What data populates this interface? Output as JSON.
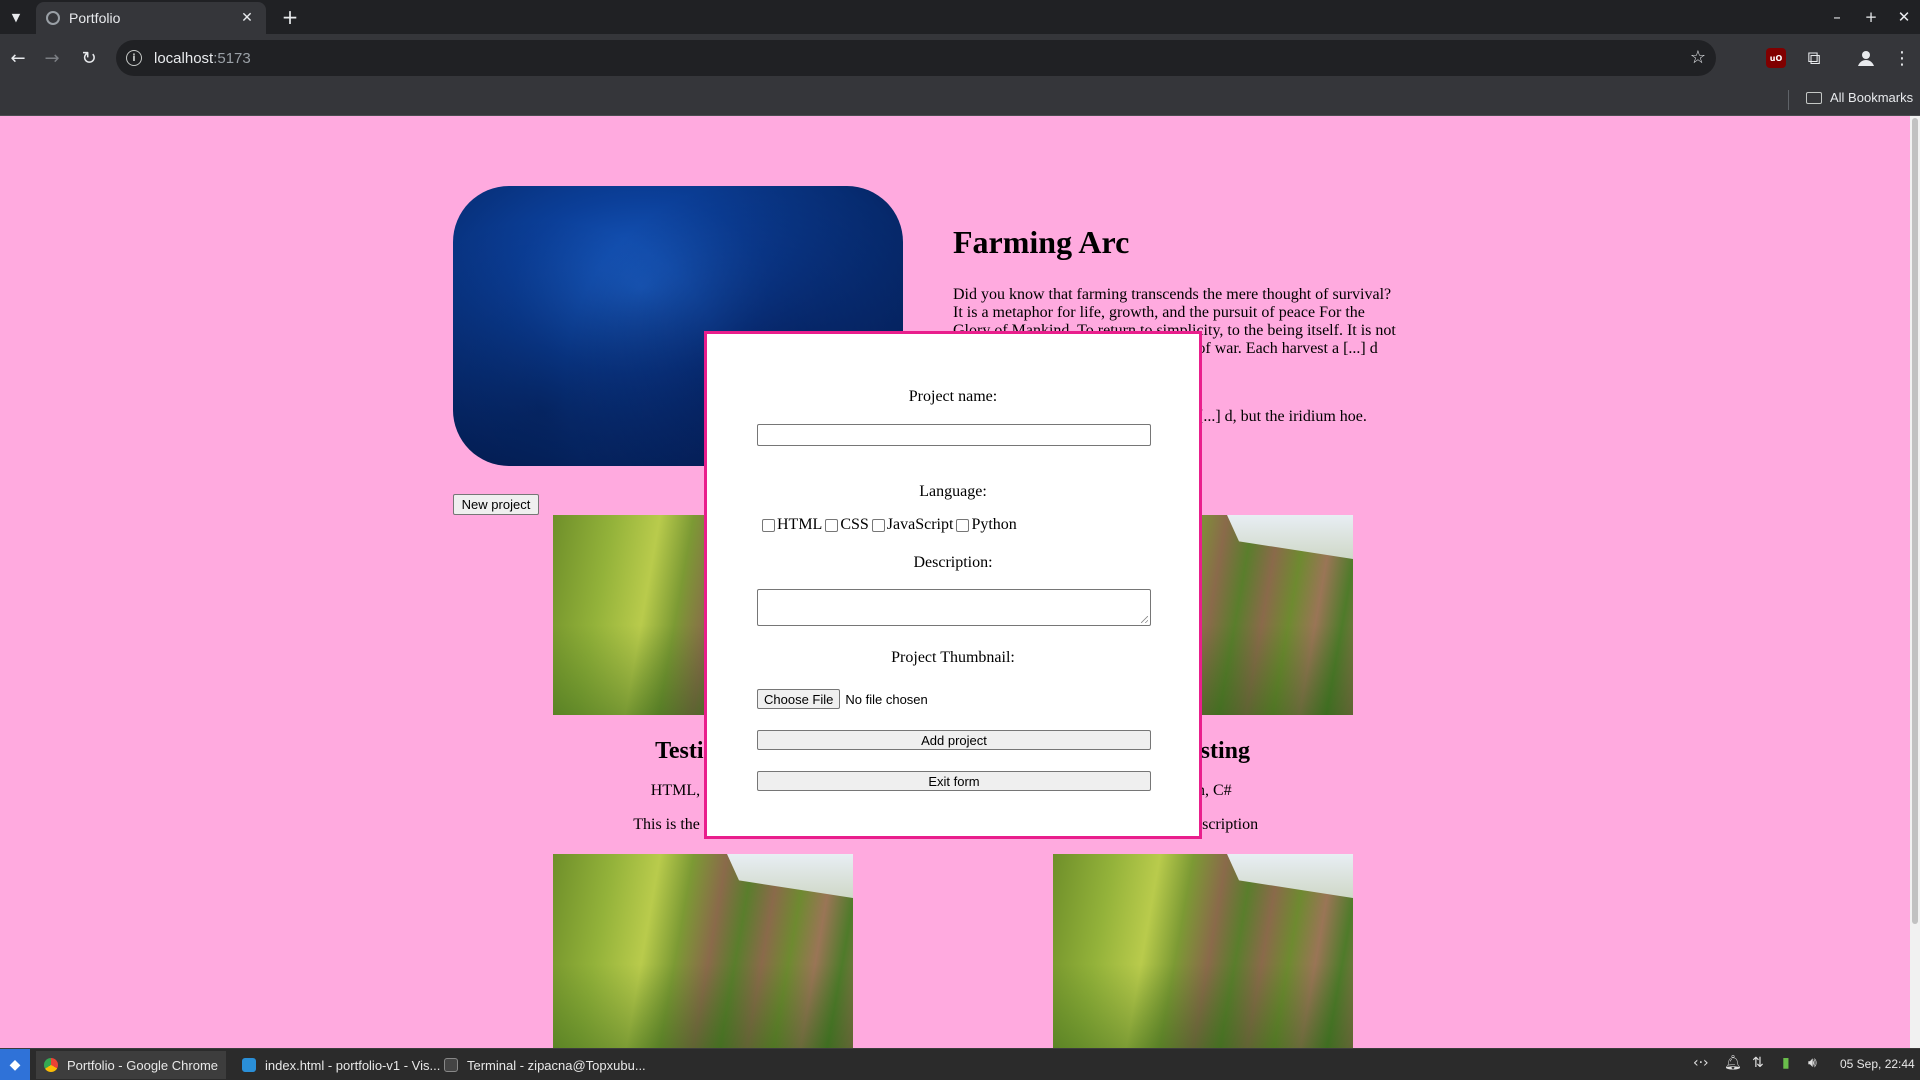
{
  "browser": {
    "tab_title": "Portfolio",
    "url_host": "localhost",
    "url_port": ":5173",
    "bookmarks_label": "All Bookmarks"
  },
  "page": {
    "title": "Farming Arc",
    "intro_text": "Did you know that farming transcends the mere thought of survival? It is a metaphor for life, growth, and the pursuit of peace For the Glory of Mankind. To return to simplicity, to the being itself. It is not [...] Each seed planted with the [...] rs of war. Each harvest a [...] d hope.",
    "intro_text_tail": "[...] d, but the iridium hoe.",
    "new_project_label": "New project",
    "cards": [
      {
        "title": "Testin[...]",
        "languages": "HTML, CSS[...]",
        "description": "This is the descrip[...]"
      },
      {
        "title": "[...]esting",
        "languages": "[...]n, C#",
        "description": "[...]er description"
      }
    ]
  },
  "form": {
    "project_name_label": "Project name:",
    "project_name_value": "",
    "language_label": "Language:",
    "languages": [
      "HTML",
      "CSS",
      "JavaScript",
      "Python"
    ],
    "description_label": "Description:",
    "description_value": "",
    "thumbnail_label": "Project Thumbnail:",
    "choose_file_label": "Choose File",
    "no_file_text": "No file chosen",
    "add_button": "Add project",
    "exit_button": "Exit form",
    "border_color": "#e91e8c"
  },
  "taskbar": {
    "items": [
      "Portfolio - Google Chrome",
      "index.html - portfolio-v1 - Vis...",
      "Terminal - zipacna@Topxubu..."
    ],
    "clock": "05 Sep, 22:44"
  },
  "colors": {
    "page_background": "#ffaadf",
    "modal_border": "#e91e8c"
  }
}
